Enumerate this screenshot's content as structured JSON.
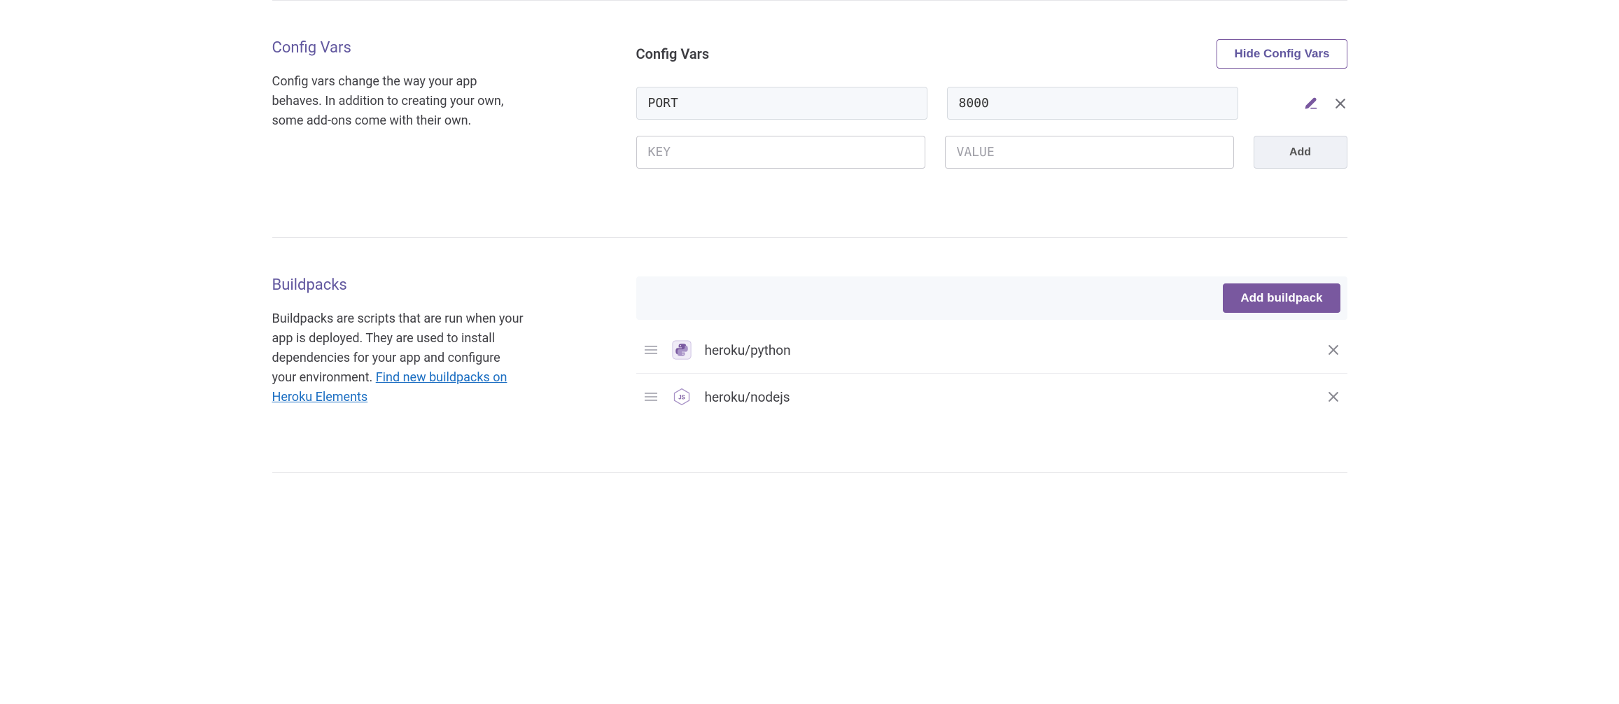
{
  "configVars": {
    "sidebarTitle": "Config Vars",
    "sidebarDesc": "Config vars change the way your app behaves. In addition to creating your own, some add-ons come with their own.",
    "headerTitle": "Config Vars",
    "hideButton": "Hide Config Vars",
    "rows": [
      {
        "key": "PORT",
        "value": "8000"
      }
    ],
    "newKeyPlaceholder": "KEY",
    "newValuePlaceholder": "VALUE",
    "addButton": "Add"
  },
  "buildpacks": {
    "sidebarTitle": "Buildpacks",
    "sidebarDescPrefix": "Buildpacks are scripts that are run when your app is deployed. They are used to install dependencies for your app and configure your environment. ",
    "sidebarLinkText": "Find new buildpacks on Heroku Elements",
    "addButton": "Add buildpack",
    "items": [
      {
        "name": "heroku/python",
        "icon": "python"
      },
      {
        "name": "heroku/nodejs",
        "icon": "nodejs"
      }
    ]
  }
}
